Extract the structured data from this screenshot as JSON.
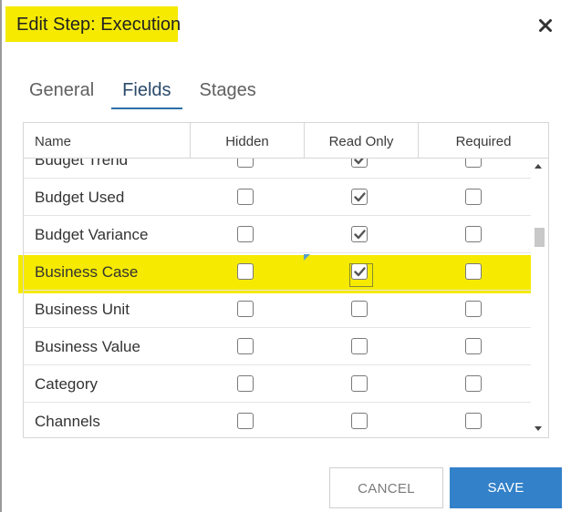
{
  "dialog": {
    "title": "Edit Step: Execution",
    "close_icon": "close-icon"
  },
  "tabs": [
    {
      "label": "General",
      "active": false
    },
    {
      "label": "Fields",
      "active": true
    },
    {
      "label": "Stages",
      "active": false
    }
  ],
  "grid": {
    "headers": {
      "name": "Name",
      "hidden": "Hidden",
      "read_only": "Read Only",
      "required": "Required"
    },
    "rows": [
      {
        "name": "Budget Trend",
        "hidden": false,
        "read_only": true,
        "required": false
      },
      {
        "name": "Budget Used",
        "hidden": false,
        "read_only": true,
        "required": false
      },
      {
        "name": "Budget Variance",
        "hidden": false,
        "read_only": true,
        "required": false
      },
      {
        "name": "Business Case",
        "hidden": false,
        "read_only": true,
        "required": false
      },
      {
        "name": "Business Unit",
        "hidden": false,
        "read_only": false,
        "required": false
      },
      {
        "name": "Business Value",
        "hidden": false,
        "read_only": false,
        "required": false
      },
      {
        "name": "Category",
        "hidden": false,
        "read_only": false,
        "required": false
      },
      {
        "name": "Channels",
        "hidden": false,
        "read_only": false,
        "required": false
      }
    ]
  },
  "buttons": {
    "cancel_label": "CANCEL",
    "save_label": "SAVE"
  },
  "colors": {
    "highlight": "#f5ea00",
    "primary": "#3381c9",
    "tab_underline": "#2f6fa8"
  }
}
